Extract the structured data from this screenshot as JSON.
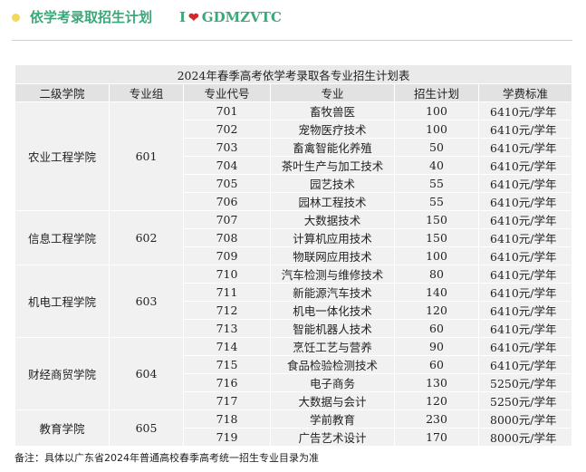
{
  "colors": {
    "accent_green": "#3aa878",
    "dot_yellow": "#f3d75a",
    "heart_red": "#d7262c"
  },
  "header": {
    "title": "依学考录取招生计划",
    "brand_prefix": "I",
    "brand_icon": "heart-icon",
    "brand_suffix": "GDMZVTC"
  },
  "table": {
    "caption": "2024年春季高考依学考录取各专业招生计划表",
    "columns": [
      "二级学院",
      "专业组",
      "专业代号",
      "专业",
      "招生计划",
      "学费标准"
    ],
    "groups": [
      {
        "college": "农业工程学院",
        "group": "601",
        "rows": [
          [
            "701",
            "畜牧兽医",
            "100",
            "6410元/学年"
          ],
          [
            "702",
            "宠物医疗技术",
            "100",
            "6410元/学年"
          ],
          [
            "703",
            "畜禽智能化养殖",
            "50",
            "6410元/学年"
          ],
          [
            "704",
            "茶叶生产与加工技术",
            "40",
            "6410元/学年"
          ],
          [
            "705",
            "园艺技术",
            "55",
            "6410元/学年"
          ],
          [
            "706",
            "园林工程技术",
            "55",
            "6410元/学年"
          ]
        ]
      },
      {
        "college": "信息工程学院",
        "group": "602",
        "rows": [
          [
            "707",
            "大数据技术",
            "150",
            "6410元/学年"
          ],
          [
            "708",
            "计算机应用技术",
            "150",
            "6410元/学年"
          ],
          [
            "709",
            "物联网应用技术",
            "100",
            "6410元/学年"
          ]
        ]
      },
      {
        "college": "机电工程学院",
        "group": "603",
        "rows": [
          [
            "710",
            "汽车检测与维修技术",
            "80",
            "6410元/学年"
          ],
          [
            "711",
            "新能源汽车技术",
            "140",
            "6410元/学年"
          ],
          [
            "712",
            "机电一体化技术",
            "120",
            "6410元/学年"
          ],
          [
            "713",
            "智能机器人技术",
            "60",
            "6410元/学年"
          ]
        ]
      },
      {
        "college": "财经商贸学院",
        "group": "604",
        "rows": [
          [
            "714",
            "烹饪工艺与营养",
            "90",
            "6410元/学年"
          ],
          [
            "715",
            "食品检验检测技术",
            "60",
            "6410元/学年"
          ],
          [
            "716",
            "电子商务",
            "130",
            "5250元/学年"
          ],
          [
            "717",
            "大数据与会计",
            "120",
            "5250元/学年"
          ]
        ]
      },
      {
        "college": "教育学院",
        "group": "605",
        "rows": [
          [
            "718",
            "学前教育",
            "230",
            "8000元/学年"
          ],
          [
            "719",
            "广告艺术设计",
            "170",
            "8000元/学年"
          ]
        ]
      }
    ]
  },
  "note": "备注：具体以广东省2024年普通高校春季高考统一招生专业目录为准"
}
